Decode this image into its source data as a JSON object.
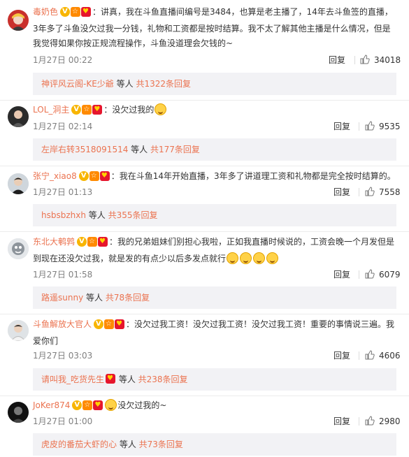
{
  "comments": [
    {
      "username": "毒奶色",
      "text": "：讲真，我在斗鱼直播间编号是3484，也算是老主播了，14年去斗鱼签的直播，3年多了斗鱼没欠过我一分钱，礼物和工资都是按时结算。我不太了解其他主播是什么情况，但是我觉得如果你按正规流程操作，斗鱼没道理会欠钱的~",
      "time": "1月27日 00:22",
      "reply_label": "回复",
      "likes": "34018",
      "sub_user": "神评风云阁-KE少爺",
      "sub_mid": " 等人 ",
      "sub_count": "共1322条回复"
    },
    {
      "username": "LOL_洞主",
      "text": "：没欠过我的",
      "time": "1月27日 02:14",
      "reply_label": "回复",
      "likes": "9535",
      "sub_user": "左岸右转3518091514",
      "sub_mid": " 等人 ",
      "sub_count": "共177条回复"
    },
    {
      "username": "张宁_xiao8",
      "text": "：我在斗鱼14年开始直播，3年多了讲道理工资和礼物都是完全按时结算的。",
      "time": "1月27日 01:13",
      "reply_label": "回复",
      "likes": "7558",
      "sub_user": "hsbsbzhxh",
      "sub_mid": " 等人 ",
      "sub_count": "共355条回复"
    },
    {
      "username": "东北大鹌鹑",
      "text": "：我的兄弟姐妹们别担心我啦，正如我直播时候说的，工资会晚一个月发但是到现在还没欠过我，就是发的有点少以后多发点就行",
      "time": "1月27日 01:58",
      "reply_label": "回复",
      "likes": "6079",
      "sub_user": "路遥sunny",
      "sub_mid": " 等人 ",
      "sub_count": "共78条回复"
    },
    {
      "username": "斗鱼解放大官人",
      "text": "：没欠过我工资！没欠过我工资！没欠过我工资！重要的事情说三遍。我爱你们",
      "time": "1月27日 03:03",
      "reply_label": "回复",
      "likes": "4606",
      "sub_user": "请叫我_吃货先生",
      "sub_mid": " 等人 ",
      "sub_count": "共238条回复"
    },
    {
      "username": "JoKer874",
      "text": "没欠过我的~",
      "time": "1月27日 01:00",
      "reply_label": "回复",
      "likes": "2980",
      "sub_user": "虎皮的番茄大虾的心",
      "sub_mid": " 等人 ",
      "sub_count": "共73条回复"
    }
  ],
  "colors": {
    "username": "#eb7350",
    "text": "#333333",
    "meta": "#808080",
    "sub_bg": "#f2f2f5"
  },
  "icons": [
    "verified-v-icon",
    "level-badge-icon",
    "member-red-badge-icon",
    "thumbs-up-icon",
    "grin-emoji-icon"
  ]
}
